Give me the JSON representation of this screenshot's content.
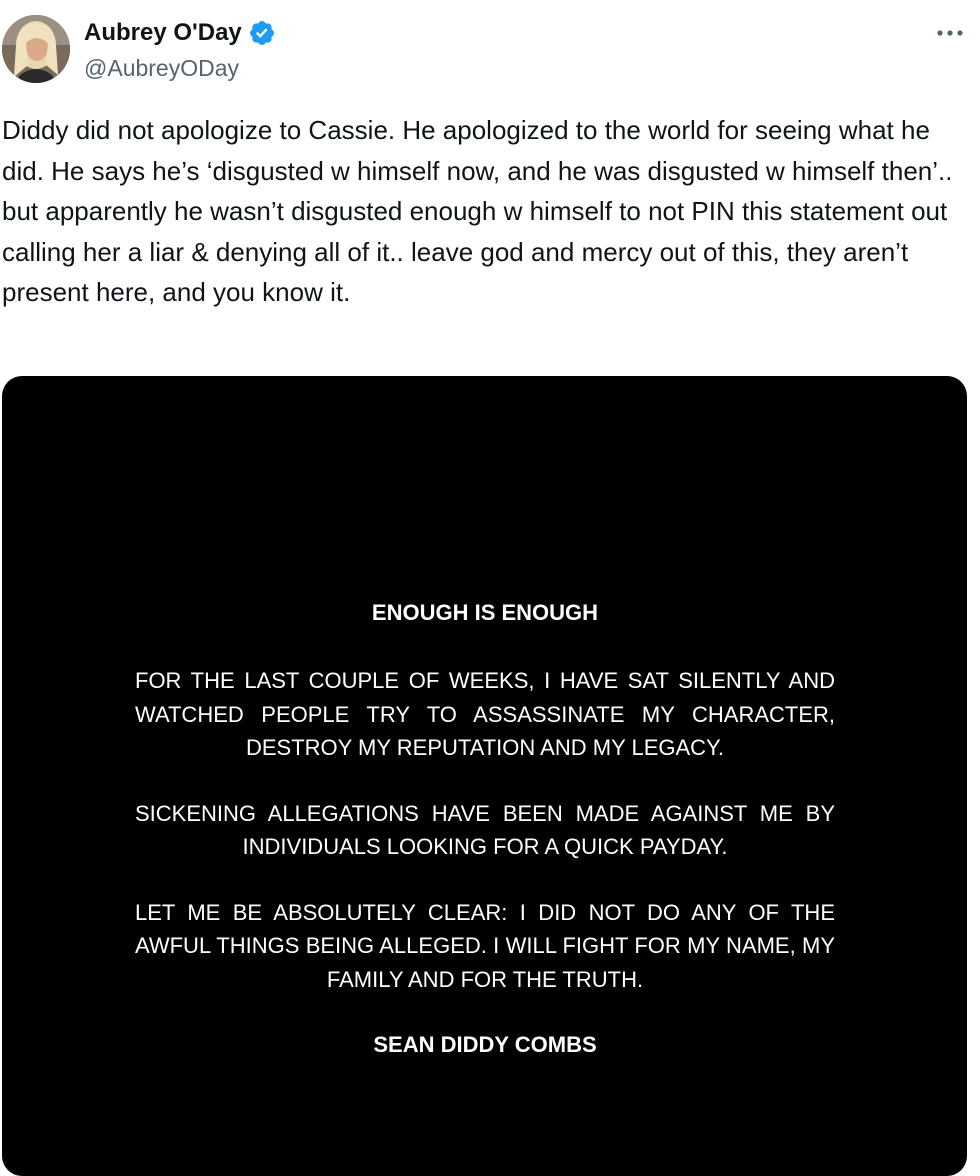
{
  "author": {
    "display_name": "Aubrey O'Day",
    "handle": "@AubreyODay",
    "verified_icon": "verified-badge-icon",
    "verified_color": "#1d9bf0"
  },
  "more_icon": "more-horizontal-icon",
  "tweet_text": "Diddy did not apologize to Cassie. He  apologized to the world for seeing what he did. He says he’s ‘disgusted w himself now, and he was disgusted w himself then’.. but apparently he wasn’t disgusted enough w himself to not PIN this statement out calling her a liar & denying all of it.. leave god and mercy out of this, they aren’t present here, and you know it.",
  "media": {
    "title": "ENOUGH IS ENOUGH",
    "paragraph_1": "FOR THE LAST COUPLE OF WEEKS, I HAVE SAT SILENTLY AND WATCHED PEOPLE TRY TO ASSASSINATE MY CHARACTER, DESTROY MY REPUTATION AND MY LEGACY.",
    "paragraph_2": "SICKENING ALLEGATIONS HAVE BEEN MADE AGAINST ME BY INDIVIDUALS LOOKING FOR A QUICK PAYDAY.",
    "paragraph_3": "LET ME BE ABSOLUTELY CLEAR: I DID NOT DO ANY OF THE AWFUL THINGS BEING ALLEGED. I WILL FIGHT FOR MY NAME, MY FAMILY AND FOR THE TRUTH.",
    "signature": "SEAN DIDDY COMBS"
  },
  "colors": {
    "text": "#0f1419",
    "secondary": "#536471",
    "media_bg": "#000000"
  }
}
